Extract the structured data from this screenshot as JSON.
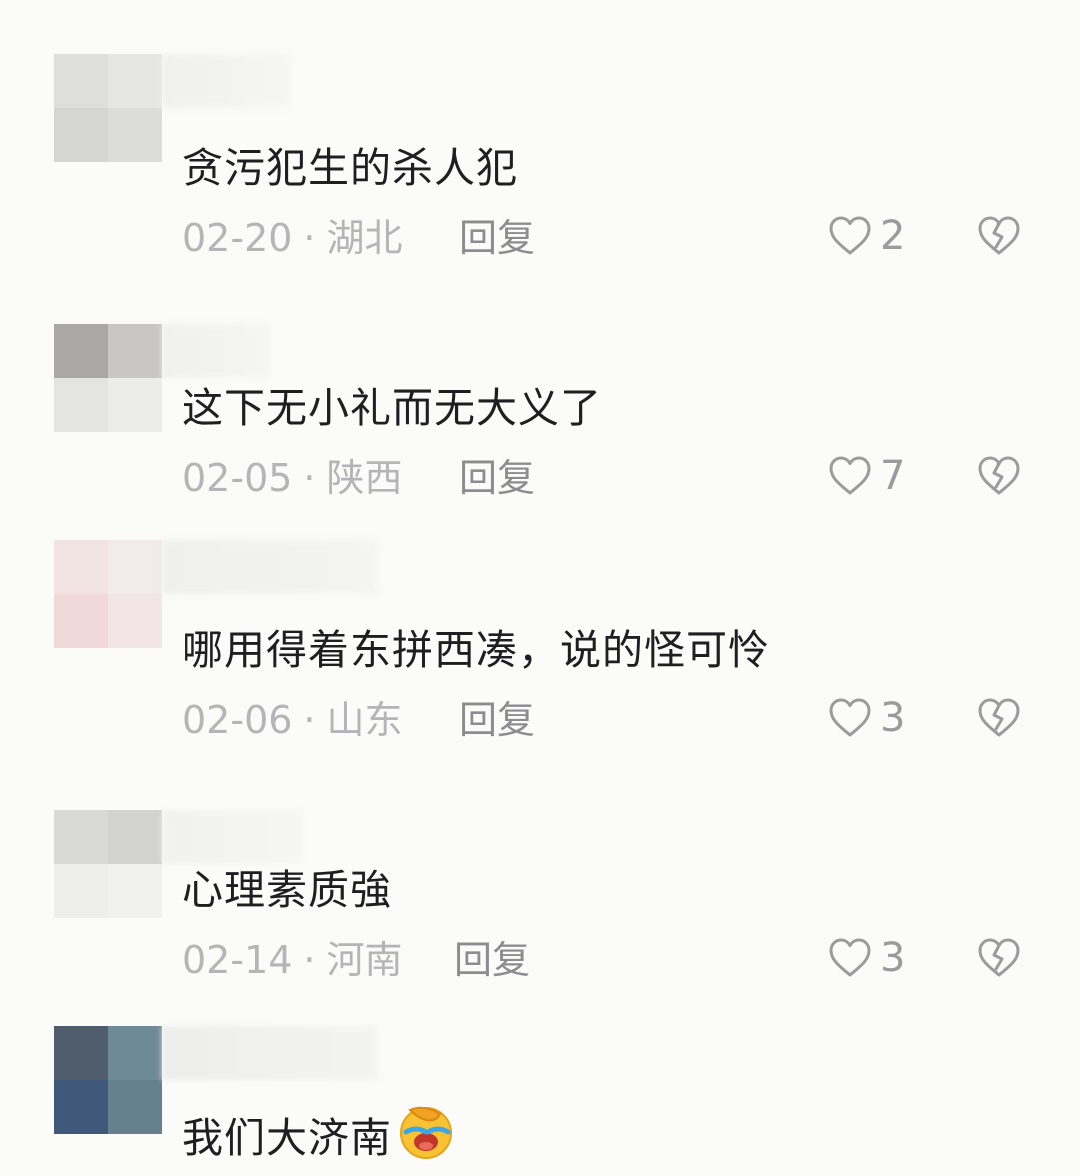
{
  "comments": [
    {
      "text": "贪污犯生的杀人犯",
      "date": "02-20",
      "location": "湖北",
      "reply_label": "回复",
      "likes": "2"
    },
    {
      "text": "这下无小礼而无大义了",
      "date": "02-05",
      "location": "陕西",
      "reply_label": "回复",
      "likes": "7"
    },
    {
      "text": "哪用得着东拼西凑，说的怪可怜",
      "date": "02-06",
      "location": "山东",
      "reply_label": "回复",
      "likes": "3"
    },
    {
      "text": "心理素质強",
      "date": "02-14",
      "location": "河南",
      "reply_label": "回复",
      "likes": "3"
    },
    {
      "text": "我们大济南",
      "emoji": "facepalm-crying-emoji"
    }
  ],
  "meta_separator": "·",
  "icons": {
    "like": "heart-outline-icon",
    "dislike": "broken-heart-icon"
  },
  "colors": {
    "background": "#fbfbf9",
    "comment_text": "#1f1f22",
    "meta_text": "#b5b5b8",
    "reply_text": "#8d8d90"
  }
}
